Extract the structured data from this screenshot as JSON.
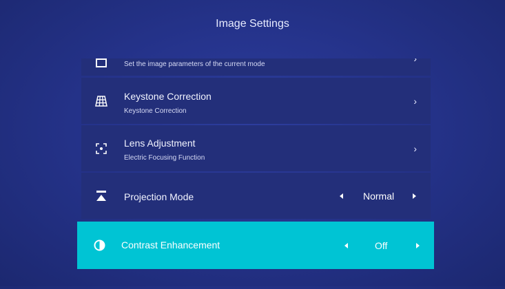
{
  "header": {
    "title": "Image Settings"
  },
  "items": [
    {
      "label": "",
      "sub": "Set the image parameters of the current mode",
      "icon": "picture-icon"
    },
    {
      "label": "Keystone Correction",
      "sub": "Keystone Correction",
      "icon": "keystone-grid-icon"
    },
    {
      "label": "Lens Adjustment",
      "sub": "Electric Focusing Function",
      "icon": "focus-icon"
    },
    {
      "label": "Projection Mode",
      "value": "Normal",
      "icon": "projection-icon"
    },
    {
      "label": "Contrast Enhancement",
      "value": "Off",
      "icon": "contrast-icon",
      "selected": true
    }
  ],
  "colors": {
    "background": "#25338b",
    "row": "#232f7a",
    "highlight": "#00c4d4"
  }
}
